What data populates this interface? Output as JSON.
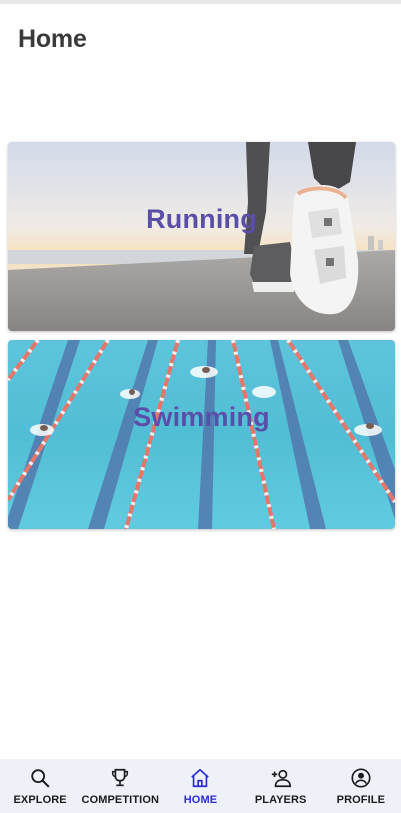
{
  "header": {
    "title": "Home"
  },
  "cards": [
    {
      "label": "Running",
      "label_color": "#5a4ea8"
    },
    {
      "label": "Swimming",
      "label_color": "#5a4ea8"
    }
  ],
  "bottom_nav": {
    "active_color": "#2b2bd4",
    "items": [
      {
        "label": "EXPLORE",
        "icon": "search-icon"
      },
      {
        "label": "COMPETITION",
        "icon": "trophy-icon"
      },
      {
        "label": "HOME",
        "icon": "home-icon",
        "active": true
      },
      {
        "label": "PLAYERS",
        "icon": "add-person-icon"
      },
      {
        "label": "PROFILE",
        "icon": "account-circle-icon"
      }
    ]
  }
}
